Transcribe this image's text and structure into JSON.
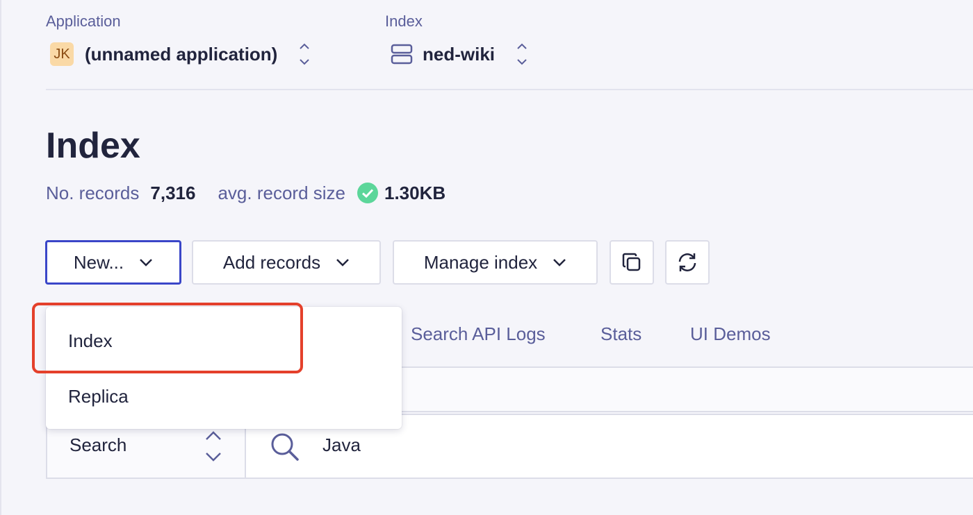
{
  "header": {
    "application": {
      "label": "Application",
      "avatar": "JK",
      "value": "(unnamed application)"
    },
    "index": {
      "label": "Index",
      "value": "ned-wiki"
    }
  },
  "page": {
    "title": "Index",
    "stats": {
      "records_label": "No. records",
      "records_value": "7,316",
      "size_label": "avg. record size",
      "size_value": "1.30KB"
    }
  },
  "toolbar": {
    "new_label": "New...",
    "add_records_label": "Add records",
    "manage_index_label": "Manage index",
    "icons": [
      "copy-icon",
      "refresh-icon"
    ]
  },
  "tabs": [
    "Search API Logs",
    "Stats",
    "UI Demos"
  ],
  "dropdown": {
    "items": [
      "Index",
      "Replica"
    ]
  },
  "search": {
    "mode": "Search",
    "query": "Java"
  },
  "colors": {
    "accent": "#3a46c8",
    "highlight": "#e4402b",
    "success": "#5cd69a",
    "muted_text": "#5a5e9a",
    "text": "#21243d"
  }
}
